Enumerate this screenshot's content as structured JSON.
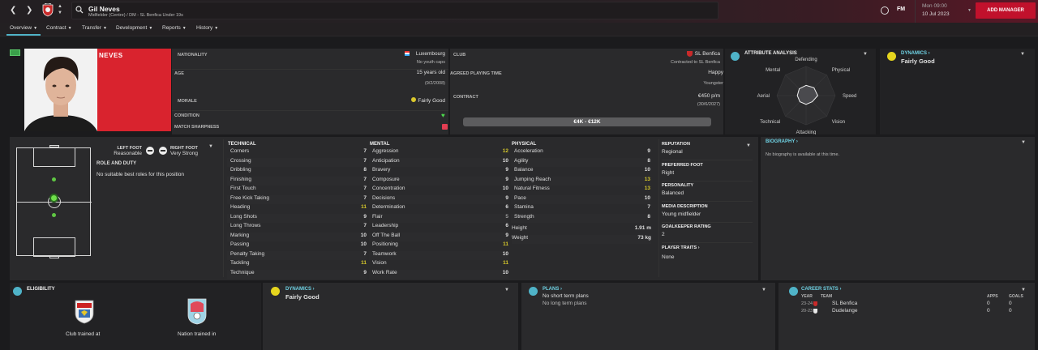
{
  "header": {
    "player_name": "Gil Neves",
    "player_subtitle": "Midfielder (Centre) / DM - SL Benfica Under 19s",
    "brand": "FM",
    "date_top": "Mon 09:00",
    "date_main": "10 Jul 2023",
    "add_manager": "ADD MANAGER"
  },
  "tabs": [
    {
      "label": "Overview"
    },
    {
      "label": "Contract"
    },
    {
      "label": "Transfer"
    },
    {
      "label": "Development"
    },
    {
      "label": "Reports"
    },
    {
      "label": "History"
    }
  ],
  "profile": {
    "surname": "NEVES",
    "nationality_label": "NATIONALITY",
    "nationality": "Luxembourg",
    "caps": "No youth caps",
    "age_label": "AGE",
    "age": "15 years old",
    "dob": "(9/2/2008)",
    "morale_label": "MORALE",
    "morale": "Fairly Good",
    "condition_label": "CONDITION",
    "sharpness_label": "MATCH SHARPNESS",
    "club_label": "CLUB",
    "club": "SL Benfica",
    "contracted": "Contracted to SL Benfica",
    "playing_time_label": "AGREED PLAYING TIME",
    "happy": "Happy",
    "playing_time": "Youngster",
    "contract_label": "CONTRACT",
    "wage": "€450 p/m",
    "expiry": "(30/6/2027)",
    "value": "€4K - €12K"
  },
  "attribute_analysis": {
    "title": "ATTRIBUTE ANALYSIS",
    "axes": [
      "Defending",
      "Physical",
      "Speed",
      "Vision",
      "Attacking",
      "Technical",
      "Aerial",
      "Mental"
    ],
    "values": [
      0.35,
      0.38,
      0.4,
      0.3,
      0.3,
      0.3,
      0.3,
      0.33
    ]
  },
  "dynamics_top": {
    "title": "DYNAMICS",
    "value": "Fairly Good"
  },
  "feet": {
    "left_label": "LEFT FOOT",
    "left": "Reasonable",
    "right_label": "RIGHT FOOT",
    "right": "Very Strong"
  },
  "role": {
    "title": "ROLE AND DUTY",
    "text": "No suitable best roles for this position"
  },
  "technical": {
    "title": "TECHNICAL",
    "rows": [
      {
        "name": "Corners",
        "value": "7"
      },
      {
        "name": "Crossing",
        "value": "7"
      },
      {
        "name": "Dribbling",
        "value": "8"
      },
      {
        "name": "Finishing",
        "value": "7"
      },
      {
        "name": "First Touch",
        "value": "7"
      },
      {
        "name": "Free Kick Taking",
        "value": "7"
      },
      {
        "name": "Heading",
        "value": "11"
      },
      {
        "name": "Long Shots",
        "value": "9"
      },
      {
        "name": "Long Throws",
        "value": "7"
      },
      {
        "name": "Marking",
        "value": "10"
      },
      {
        "name": "Passing",
        "value": "10"
      },
      {
        "name": "Penalty Taking",
        "value": "7"
      },
      {
        "name": "Tackling",
        "value": "11"
      },
      {
        "name": "Technique",
        "value": "9"
      }
    ]
  },
  "mental": {
    "title": "MENTAL",
    "rows": [
      {
        "name": "Aggression",
        "value": "12"
      },
      {
        "name": "Anticipation",
        "value": "10"
      },
      {
        "name": "Bravery",
        "value": "9"
      },
      {
        "name": "Composure",
        "value": "9"
      },
      {
        "name": "Concentration",
        "value": "10"
      },
      {
        "name": "Decisions",
        "value": "9"
      },
      {
        "name": "Determination",
        "value": "6"
      },
      {
        "name": "Flair",
        "value": "5"
      },
      {
        "name": "Leadership",
        "value": "6"
      },
      {
        "name": "Off The Ball",
        "value": "9"
      },
      {
        "name": "Positioning",
        "value": "11"
      },
      {
        "name": "Teamwork",
        "value": "10"
      },
      {
        "name": "Vision",
        "value": "11"
      },
      {
        "name": "Work Rate",
        "value": "10"
      }
    ]
  },
  "physical": {
    "title": "PHYSICAL",
    "rows": [
      {
        "name": "Acceleration",
        "value": "9"
      },
      {
        "name": "Agility",
        "value": "8"
      },
      {
        "name": "Balance",
        "value": "10"
      },
      {
        "name": "Jumping Reach",
        "value": "13"
      },
      {
        "name": "Natural Fitness",
        "value": "13"
      },
      {
        "name": "Pace",
        "value": "10"
      },
      {
        "name": "Stamina",
        "value": "7"
      },
      {
        "name": "Strength",
        "value": "8"
      }
    ],
    "height_label": "Height",
    "height": "1.91 m",
    "weight_label": "Weight",
    "weight": "73 kg"
  },
  "info": {
    "reputation_label": "REPUTATION",
    "reputation": "Regional",
    "foot_label": "PREFERRED FOOT",
    "foot": "Right",
    "personality_label": "PERSONALITY",
    "personality": "Balanced",
    "media_label": "MEDIA DESCRIPTION",
    "media": "Young midfielder",
    "gk_label": "GOALKEEPER RATING",
    "gk": "2",
    "traits_label": "PLAYER TRAITS",
    "traits": "None"
  },
  "biography": {
    "title": "BIOGRAPHY",
    "text": "No biography is available at this time."
  },
  "eligibility": {
    "title": "ELIGIBILITY",
    "club_trained": "Club trained at",
    "nation_trained": "Nation trained in"
  },
  "dynamics_bottom": {
    "title": "DYNAMICS",
    "value": "Fairly Good"
  },
  "plans": {
    "title": "PLANS",
    "short": "No short term plans",
    "long": "No long term plans"
  },
  "career": {
    "title": "CAREER STATS",
    "col_year": "YEAR",
    "col_team": "TEAM",
    "col_apps": "APPS",
    "col_goals": "GOALS",
    "rows": [
      {
        "year": "23-24",
        "team": "SL Benfica",
        "apps": "0",
        "goals": "0"
      },
      {
        "year": "20-23",
        "team": "Dudelange",
        "apps": "0",
        "goals": "0"
      }
    ]
  },
  "colors": {
    "accent": "#4fb3c8",
    "brand_red": "#c1112c",
    "highlight": "#d9c72c",
    "portrait_bg": "#d9232e"
  }
}
